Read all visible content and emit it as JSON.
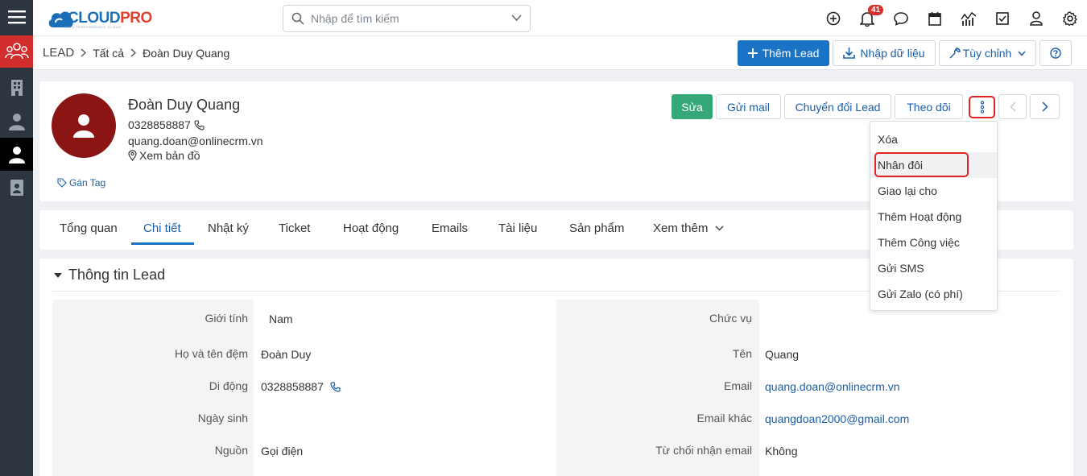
{
  "app": {
    "logo_main": "CLOUD",
    "logo_accent": "PRO",
    "logo_tagline": "HIGH PERFORMANCE CLOUD"
  },
  "colors": {
    "sidebar_bg": "#2d3640",
    "sidebar_active_red": "#d22e2e",
    "primary_blue": "#1a73c4",
    "edit_green": "#36a877",
    "avatar_red": "#8b1515",
    "highlight_red": "#e02424"
  },
  "sidebar": {
    "items": [
      {
        "icon": "menu-icon"
      },
      {
        "icon": "leads-group-icon"
      },
      {
        "icon": "building-icon"
      },
      {
        "icon": "contacts-icon"
      },
      {
        "icon": "person-icon"
      },
      {
        "icon": "document-person-icon"
      }
    ]
  },
  "search": {
    "placeholder": "Nhập để tìm kiếm"
  },
  "topbar": {
    "icons": [
      "add-icon",
      "bell-icon",
      "chat-icon",
      "calendar-icon",
      "reports-icon",
      "tasks-icon",
      "user-icon",
      "settings-icon"
    ],
    "notification_count": "41"
  },
  "breadcrumb": {
    "root": "LEAD",
    "level2": "Tất cả",
    "current": "Đoàn Duy Quang"
  },
  "actions": {
    "add": "Thêm Lead",
    "import": "Nhập dữ liệu",
    "customize": "Tùy chỉnh"
  },
  "profile": {
    "name": "Đoàn Duy Quang",
    "phone": "0328858887",
    "email": "quang.doan@onlinecrm.vn",
    "map": "Xem bản đồ",
    "tag": "Gán Tag"
  },
  "profile_actions": {
    "edit": "Sửa",
    "mail": "Gửi mail",
    "convert": "Chuyển đổi Lead",
    "follow": "Theo dõi"
  },
  "tabs": [
    "Tổng quan",
    "Chi tiết",
    "Nhật ký",
    "Ticket",
    "Hoạt động",
    "Emails",
    "Tài liệu",
    "Sản phẩm",
    "Xem thêm"
  ],
  "active_tab": "Chi tiết",
  "section": {
    "title": "Thông tin Lead"
  },
  "fields_left": [
    {
      "label": "Giới tính",
      "value": "Nam"
    },
    {
      "label": "Họ và tên đệm",
      "value": "Đoàn Duy"
    },
    {
      "label": "Di động",
      "value": "0328858887"
    },
    {
      "label": "Ngày sinh",
      "value": ""
    },
    {
      "label": "Nguồn",
      "value": "Gọi điện"
    }
  ],
  "fields_right": [
    {
      "label": "Chức vụ",
      "value": ""
    },
    {
      "label": "Tên",
      "value": "Quang"
    },
    {
      "label": "Email",
      "value": "quang.doan@onlinecrm.vn"
    },
    {
      "label": "Email khác",
      "value": "quangdoan2000@gmail.com"
    },
    {
      "label": "Từ chối nhận email",
      "value": "Không"
    }
  ],
  "more_menu": {
    "items": [
      "Xóa",
      "Nhân đôi",
      "Giao lại cho",
      "Thêm Hoạt động",
      "Thêm Công việc",
      "Gửi SMS",
      "Gửi Zalo (có phí)"
    ],
    "highlighted": "Nhân đôi"
  }
}
